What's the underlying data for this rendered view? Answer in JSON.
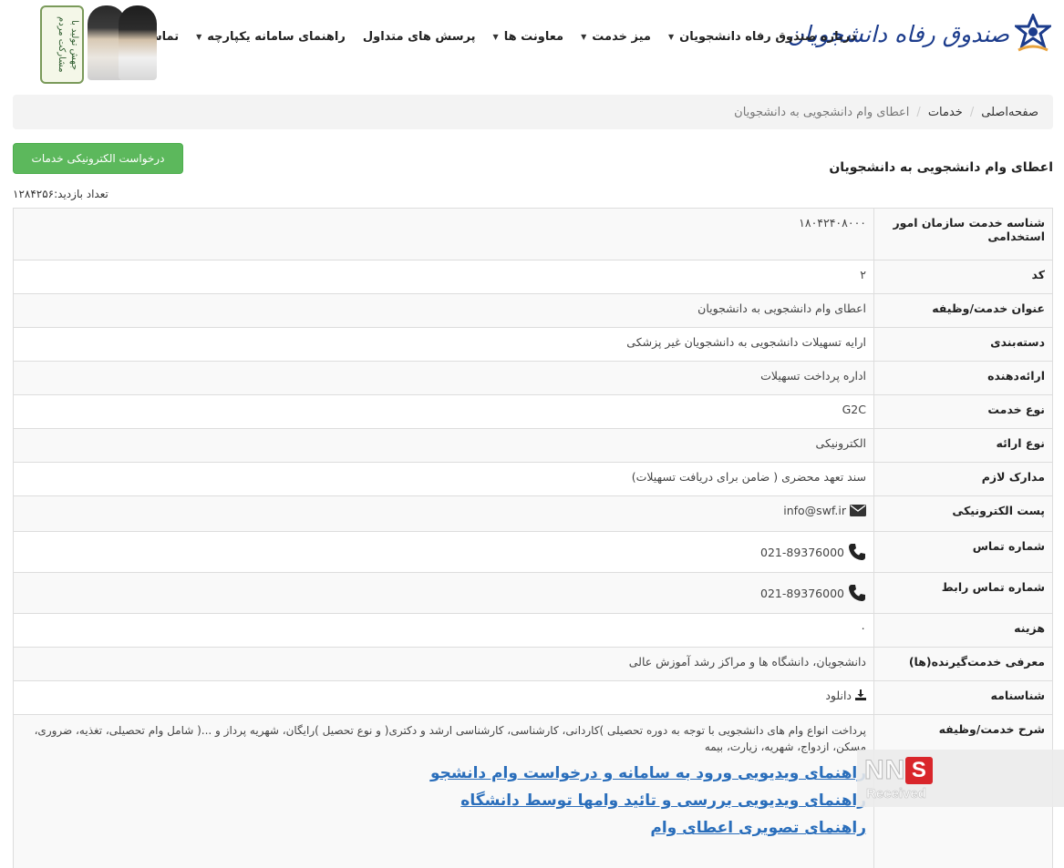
{
  "header": {
    "logo_text": "صندوق رفاه دانشجویان",
    "nav": [
      {
        "label": "درباره صندوق رفاه دانشجویان",
        "dropdown": true
      },
      {
        "label": "میز خدمت",
        "dropdown": true
      },
      {
        "label": "معاونت ها",
        "dropdown": true
      },
      {
        "label": "پرسش های متداول",
        "dropdown": false
      },
      {
        "label": "راهنمای سامانه یکپارچه",
        "dropdown": true
      },
      {
        "label": "تماس با ما",
        "dropdown": true
      }
    ],
    "banner_text": "جهش تولید با مشارکت مردم"
  },
  "breadcrumb": [
    "صفحه‌اصلی",
    "خدمات",
    "اعطای وام دانشجویی به دانشجویان"
  ],
  "service": {
    "title": "اعطای وام دانشجویی به دانشجویان",
    "request_button": "درخواست الکترونیکی خدمات",
    "visit_count": "تعداد بازدید:۱۲۸۴۲۵۶"
  },
  "table": {
    "rows": [
      {
        "label": "شناسه خدمت سازمان امور استخدامی",
        "value": "۱۸۰۴۲۴۰۸۰۰۰"
      },
      {
        "label": "کد",
        "value": "۲"
      },
      {
        "label": "عنوان خدمت/وظیفه",
        "value": "اعطای وام دانشجویی به دانشجویان"
      },
      {
        "label": "دسته‌بندی",
        "value": "ارایه تسهیلات دانشجویی به دانشجویان غیر پزشکی"
      },
      {
        "label": "ارائه‌دهنده",
        "value": "اداره پرداخت تسهیلات"
      },
      {
        "label": "نوع خدمت",
        "value": "G2C"
      },
      {
        "label": "نوع ارائه",
        "value": "الکترونیکی"
      },
      {
        "label": "مدارک لازم",
        "value": "سند تعهد محضری ( ضامن برای دریافت تسهیلات)"
      },
      {
        "label": "پست الکترونیکی",
        "value": "info@swf.ir"
      },
      {
        "label": "شماره تماس",
        "value": "021-89376000"
      },
      {
        "label": "شماره تماس رابط",
        "value": "021-89376000"
      },
      {
        "label": "هزینه",
        "value": "۰"
      },
      {
        "label": "معرفی خدمت‌گیرنده(ها)",
        "value": "دانشجویان، دانشگاه ها و مراکز رشد آموزش عالی"
      },
      {
        "label": "شناسنامه",
        "value": "دانلود"
      },
      {
        "label": "شرح خدمت/وظیفه",
        "value": "پرداخت انواع وام های دانشجویی با توجه به دوره تحصیلی )کاردانی، کارشناسی، کارشناسی ارشد و دکتری( و نوع تحصیل )رایگان، شهریه پرداز و ...( شامل وام تحصیلی، تغذیه، ضروری، مسکن، ازدواج، شهریه، زیارت، بیمه"
      }
    ],
    "guide_links": [
      "راهنمای ویدیویی ورود به سامانه و درخواست وام دانشجو",
      "راهنمای ویدیویی بررسی و تائید وامها توسط دانشگاه",
      "راهنمای تصویری اعطای وام"
    ]
  },
  "watermark": {
    "logo": "SNN",
    "subtext": "Received"
  }
}
